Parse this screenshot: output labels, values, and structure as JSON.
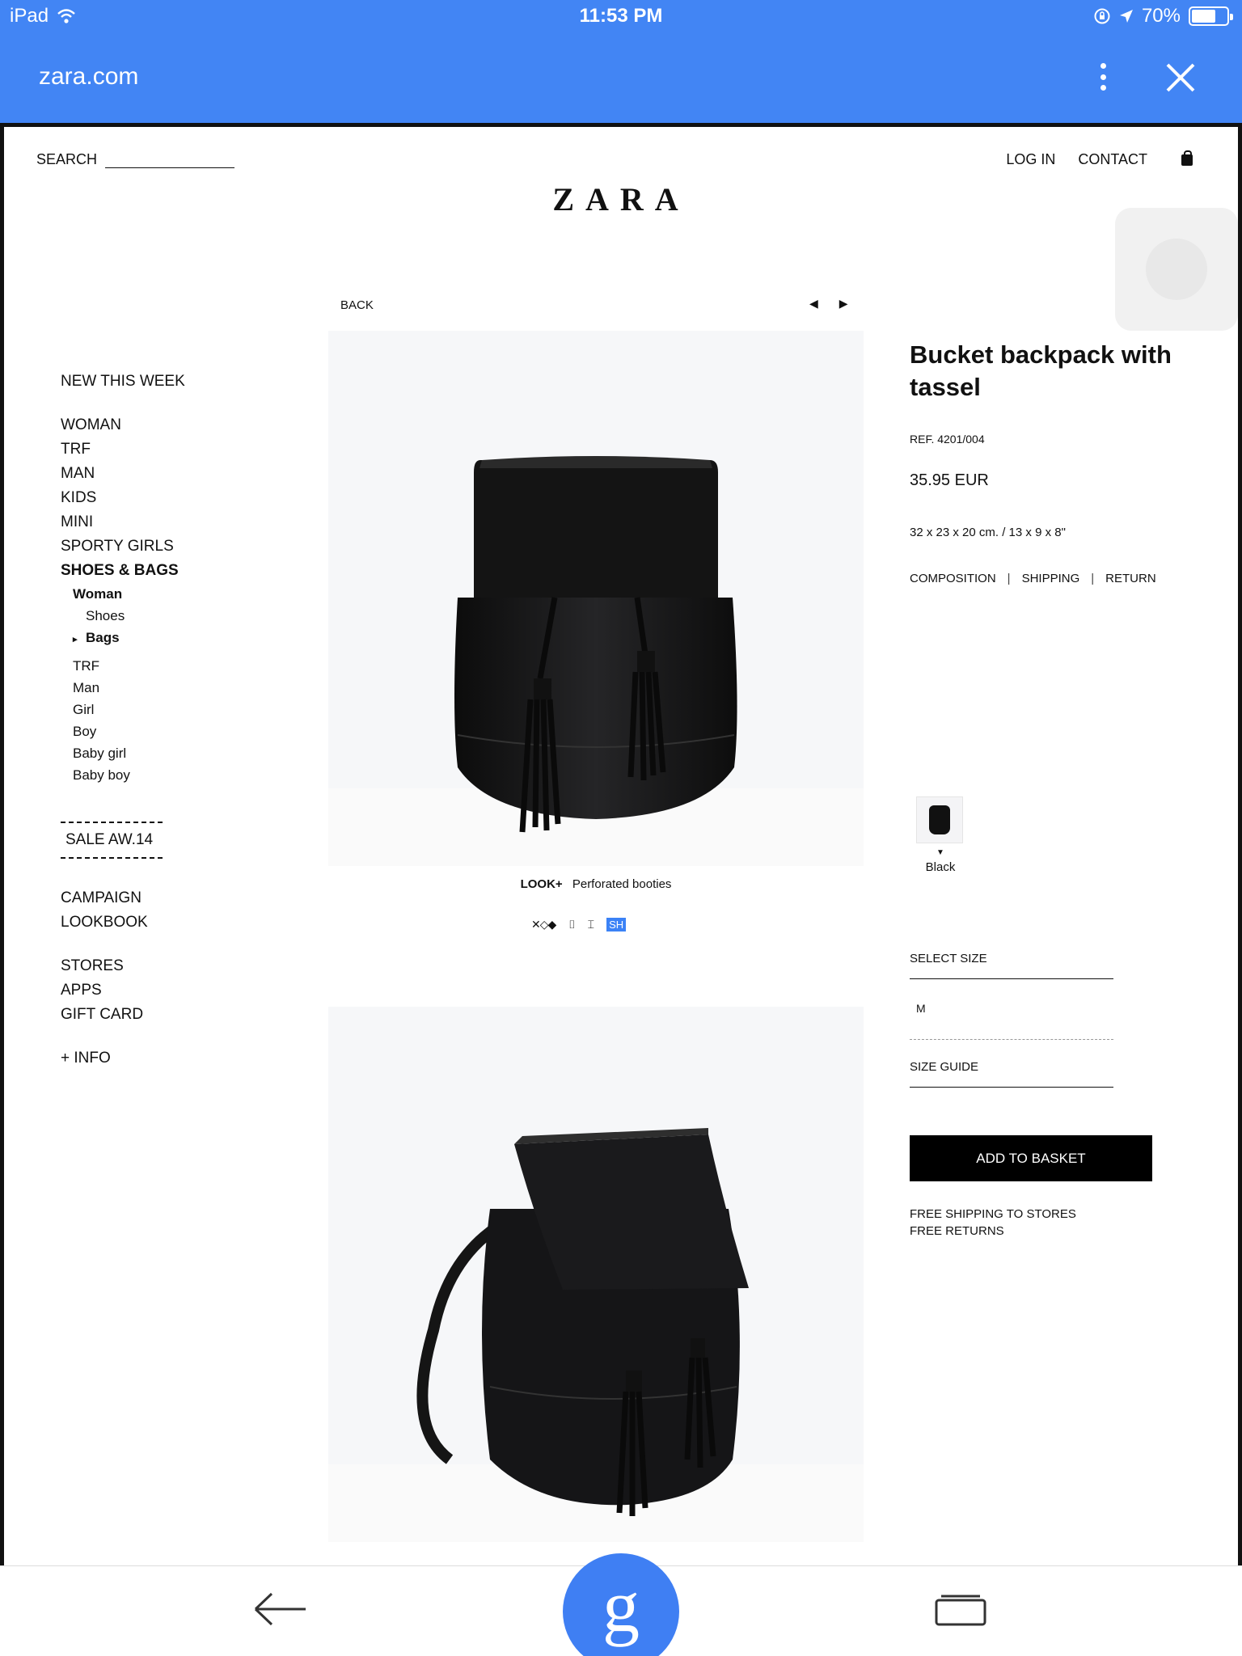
{
  "status": {
    "device": "iPad",
    "time": "11:53 PM",
    "battery": "70%",
    "battery_level": 0.7
  },
  "browser": {
    "url": "zara.com"
  },
  "header": {
    "search_label": "SEARCH",
    "login": "LOG IN",
    "contact": "CONTACT",
    "logo": "ZARA"
  },
  "sidebar": {
    "new": "NEW THIS WEEK",
    "sections": [
      "WOMAN",
      "TRF",
      "MAN",
      "KIDS",
      "MINI",
      "SPORTY GIRLS",
      "SHOES & BAGS"
    ],
    "woman": "Woman",
    "shoes": "Shoes",
    "bags": "Bags",
    "subs": [
      "TRF",
      "Man",
      "Girl",
      "Boy",
      "Baby girl",
      "Baby boy"
    ],
    "sale": "SALE AW.14",
    "campaign": "CAMPAIGN",
    "lookbook": "LOOKBOOK",
    "stores": "STORES",
    "apps": "APPS",
    "gift": "GIFT CARD",
    "info": "+ INFO"
  },
  "product": {
    "back": "BACK",
    "title": "Bucket backpack with tassel",
    "ref": "REF. 4201/004",
    "price": "35.95 EUR",
    "dims": "32 x 23 x 20 cm. / 13 x 9 x 8\"",
    "tabs": [
      "COMPOSITION",
      "SHIPPING",
      "RETURN"
    ],
    "color": "Black",
    "select_size": "SELECT SIZE",
    "size": "M",
    "size_guide": "SIZE GUIDE",
    "add": "ADD TO BASKET",
    "note1": "FREE SHIPPING TO STORES",
    "note2": "FREE RETURNS",
    "look_label": "LOOK+",
    "look_item": "Perforated booties",
    "share_label": "SH"
  },
  "colors": {
    "brand_blue": "#4285f4",
    "black": "#000000"
  },
  "icons": [
    "wifi-icon",
    "lock-rotation-icon",
    "location-icon",
    "battery-icon",
    "more-vert-icon",
    "close-icon",
    "basket-icon",
    "prev-arrow-icon",
    "next-arrow-icon",
    "back-arrow-icon",
    "google-icon",
    "tabs-icon"
  ]
}
